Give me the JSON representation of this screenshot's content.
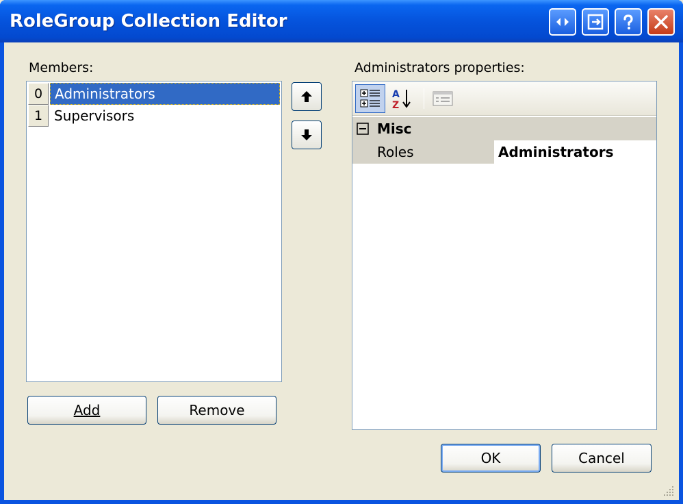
{
  "window": {
    "title": "RoleGroup Collection Editor",
    "title_buttons": [
      "swap-icon",
      "restore-icon",
      "help-icon",
      "close-icon"
    ],
    "colors": {
      "titlebar": "#0553dc",
      "selection": "#316ac5",
      "face": "#ece9d8"
    }
  },
  "members": {
    "label": "Members:",
    "items": [
      {
        "index": "0",
        "label": "Administrators",
        "selected": true
      },
      {
        "index": "1",
        "label": "Supervisors",
        "selected": false
      }
    ],
    "add_label": "Add",
    "remove_label": "Remove"
  },
  "properties": {
    "label": "Administrators properties:",
    "toolbar": [
      "categorized-icon",
      "alphabetical-icon",
      "property-pages-icon"
    ],
    "category": {
      "expander": "⊟",
      "label": "Misc"
    },
    "rows": [
      {
        "name": "Roles",
        "value": "Administrators"
      }
    ]
  },
  "footer": {
    "ok_label": "OK",
    "cancel_label": "Cancel"
  }
}
